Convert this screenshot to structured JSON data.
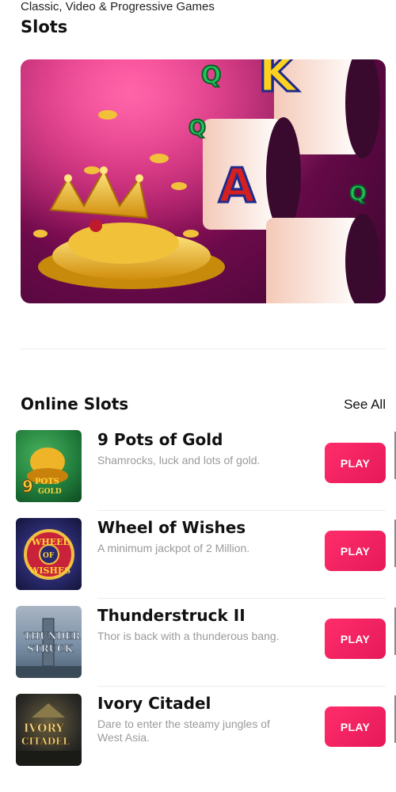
{
  "header": {
    "subtitle": "Classic, Video & Progressive Games",
    "title": "Slots"
  },
  "hero": {
    "banner_image": "slots-banner-crown-coins-reels"
  },
  "section": {
    "title": "Online Slots",
    "see_all_label": "See All"
  },
  "games": [
    {
      "name": "9 Pots of Gold",
      "description": "Shamrocks, luck and lots of gold.",
      "play_label": "PLAY",
      "thumb_text": "9 POTS OF GOLD",
      "thumb_color": "#1f7a3a"
    },
    {
      "name": "Wheel of Wishes",
      "description": "A minimum jackpot of 2 Million.",
      "play_label": "PLAY",
      "thumb_text": "WHEEL OF WISHES",
      "thumb_color": "#2a2a6e"
    },
    {
      "name": "Thunderstruck II",
      "description": "Thor is back with a thunderous bang.",
      "play_label": "PLAY",
      "thumb_text": "THUNDER STRUCK II",
      "thumb_color": "#7a8fa6"
    },
    {
      "name": "Ivory Citadel",
      "description": "Dare to enter the steamy jungles of West Asia.",
      "play_label": "PLAY",
      "thumb_text": "IVORY CITADEL",
      "thumb_color": "#2b2a26"
    }
  ],
  "colors": {
    "play_button": "#f0245f",
    "description_text": "#9a9a9a"
  }
}
